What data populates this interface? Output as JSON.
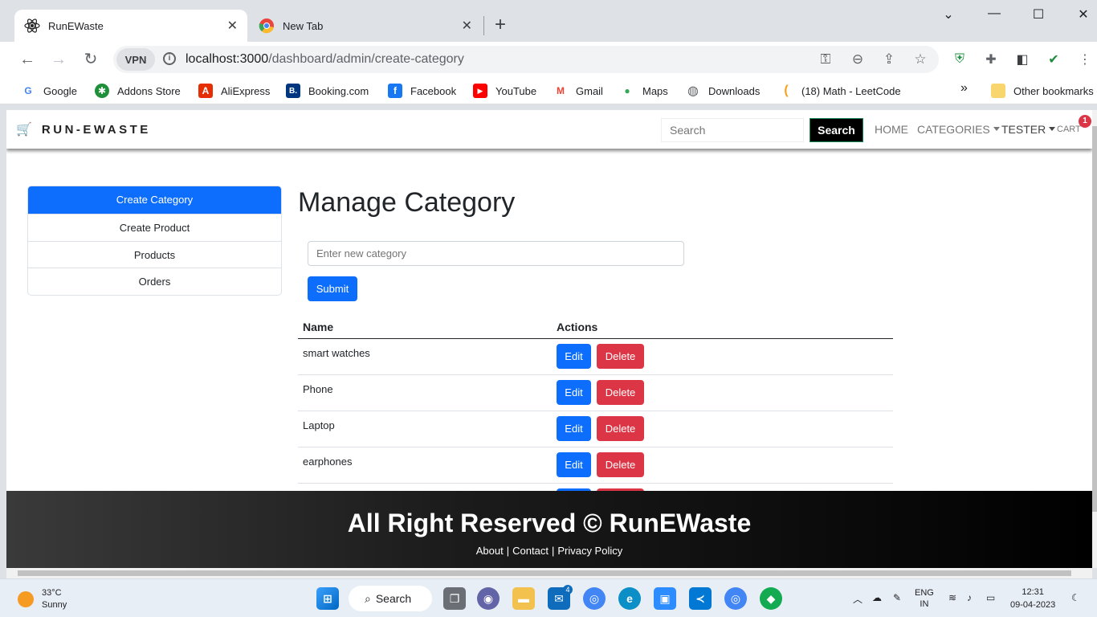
{
  "browser": {
    "tabs": [
      {
        "title": "RunEWaste",
        "active": true
      },
      {
        "title": "New Tab",
        "active": false
      }
    ],
    "vpn_label": "VPN",
    "url_host": "localhost:3000",
    "url_path": "/dashboard/admin/create-category",
    "bookmarks": [
      {
        "label": "Google",
        "icon": "G",
        "color": "#4285f4"
      },
      {
        "label": "Addons Store",
        "icon": "✱",
        "color": "#1f8f3a"
      },
      {
        "label": "AliExpress",
        "icon": "A",
        "color": "#e62e04"
      },
      {
        "label": "Booking.com",
        "icon": "B.",
        "color": "#003580"
      },
      {
        "label": "Facebook",
        "icon": "f",
        "color": "#1877f2"
      },
      {
        "label": "YouTube",
        "icon": "▶",
        "color": "#ff0000"
      },
      {
        "label": "Gmail",
        "icon": "M",
        "color": "#ea4335"
      },
      {
        "label": "Maps",
        "icon": "●",
        "color": "#34a853"
      },
      {
        "label": "Downloads",
        "icon": "◍",
        "color": "#5f6368"
      },
      {
        "label": "(18) Math - LeetCode",
        "icon": "(",
        "color": "#f89f1b"
      }
    ],
    "bookmarks_more": "»",
    "other_bookmarks": "Other bookmarks"
  },
  "navbar": {
    "brand": "RUN-EWASTE",
    "search_placeholder": "Search",
    "search_button": "Search",
    "home": "HOME",
    "categories": "CATEGORIES",
    "user": "TESTER",
    "cart": "CART",
    "cart_count": "1"
  },
  "sidebar": {
    "items": [
      {
        "label": "Create Category",
        "active": true
      },
      {
        "label": "Create Product",
        "active": false
      },
      {
        "label": "Products",
        "active": false
      },
      {
        "label": "Orders",
        "active": false
      }
    ]
  },
  "main": {
    "title": "Manage Category",
    "input_placeholder": "Enter new category",
    "submit": "Submit",
    "table": {
      "headers": [
        "Name",
        "Actions"
      ],
      "rows": [
        {
          "name": "smart watches"
        },
        {
          "name": "Phone"
        },
        {
          "name": "Laptop"
        },
        {
          "name": "earphones"
        }
      ],
      "edit_label": "Edit",
      "delete_label": "Delete"
    }
  },
  "footer": {
    "title": "All Right Reserved © RunEWaste",
    "links": [
      "About",
      "Contact",
      "Privacy Policy"
    ]
  },
  "taskbar": {
    "weather_temp": "33°C",
    "weather_desc": "Sunny",
    "search_label": "Search",
    "mail_badge": "4",
    "lang": "ENG",
    "region": "IN",
    "time": "12:31",
    "date": "09-04-2023"
  }
}
